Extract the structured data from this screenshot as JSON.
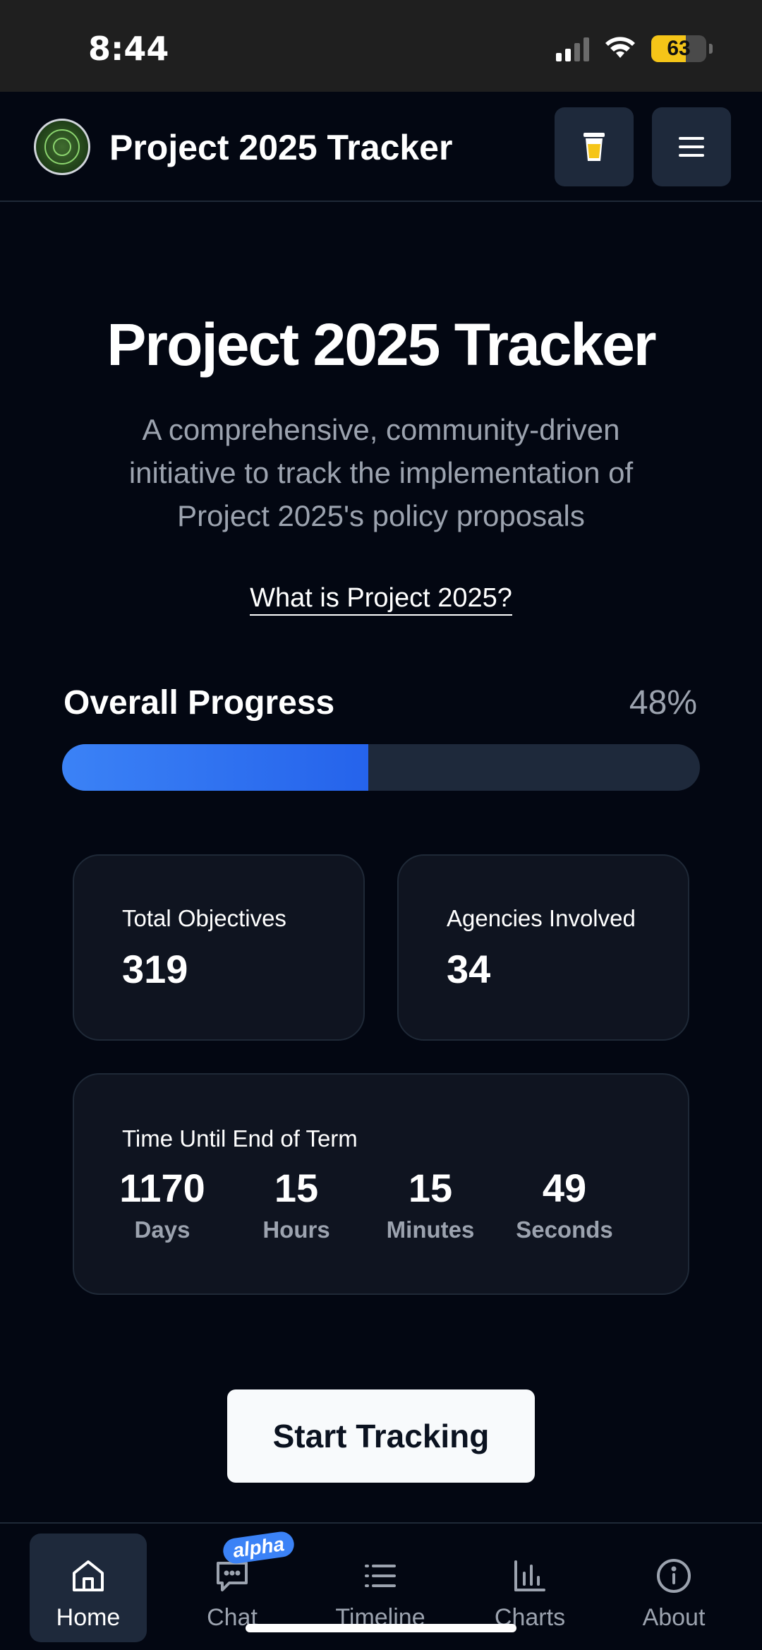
{
  "status_bar": {
    "time": "8:44",
    "battery": "63"
  },
  "header": {
    "title": "Project 2025 Tracker"
  },
  "hero": {
    "title": "Project 2025 Tracker",
    "subtitle": "A comprehensive, community-driven initiative to track the implementation of Project 2025's policy proposals",
    "link": "What is Project 2025?"
  },
  "progress": {
    "label": "Overall Progress",
    "percent_text": "48%",
    "value": 0.48
  },
  "stats": {
    "objectives": {
      "label": "Total Objectives",
      "value": "319"
    },
    "agencies": {
      "label": "Agencies Involved",
      "value": "34"
    }
  },
  "countdown": {
    "label": "Time Until End of Term",
    "units": [
      {
        "value": "1170",
        "label": "Days"
      },
      {
        "value": "15",
        "label": "Hours"
      },
      {
        "value": "15",
        "label": "Minutes"
      },
      {
        "value": "49",
        "label": "Seconds"
      }
    ]
  },
  "cta": {
    "label": "Start Tracking"
  },
  "nav": {
    "items": [
      {
        "label": "Home",
        "icon": "home-icon",
        "active": true
      },
      {
        "label": "Chat",
        "icon": "chat-icon",
        "badge": "alpha"
      },
      {
        "label": "Timeline",
        "icon": "list-icon"
      },
      {
        "label": "Charts",
        "icon": "bar-chart-icon"
      },
      {
        "label": "About",
        "icon": "info-icon"
      }
    ]
  },
  "colors": {
    "accent": "#3b82f6",
    "background": "#030712",
    "card": "#0f1420"
  }
}
